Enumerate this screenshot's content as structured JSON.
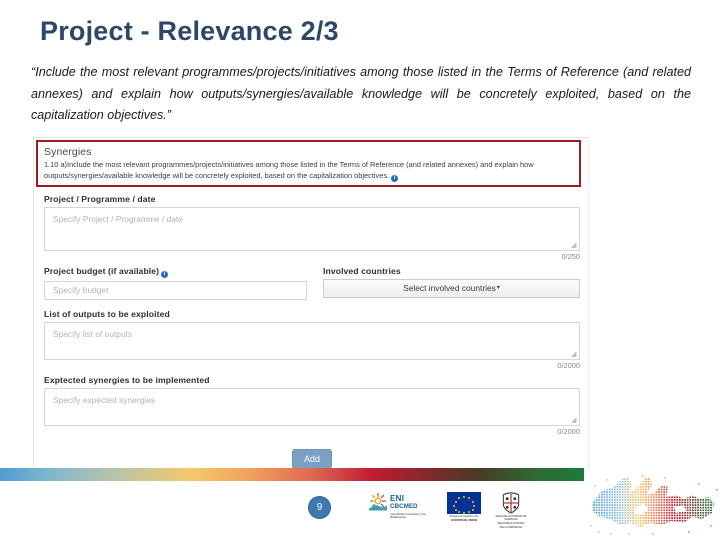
{
  "slide": {
    "title": "Project - Relevance 2/3",
    "intro": "“Include the most relevant programmes/projects/initiatives among those listed in the Terms of Reference (and related annexes) and explain how outputs/synergies/available knowledge will be concretely exploited, based on the capitalization objectives.”"
  },
  "screenshot": {
    "highlight": {
      "title": "Synergies",
      "text": "1.10 a)Include the most relevant programmes/projects/initiatives among those listed in the Terms of Reference (and related annexes) and explain how outputs/synergies/available knowledge will be concretely exploited, based on the capitalization objectives.",
      "info_icon": "info-icon",
      "border_color": "#9e1b20"
    },
    "fields": {
      "project_programme_date": {
        "label": "Project / Programme / date",
        "placeholder": "Specify Project / Programme / date",
        "value": "",
        "counter": "0/250"
      },
      "project_budget": {
        "label": "Project budget (if available)",
        "placeholder": "Specify budget",
        "value": "",
        "info_icon": "info-icon"
      },
      "involved_countries": {
        "label": "Involved countries",
        "button_label": "Select involved countries",
        "caret": "▾"
      },
      "list_of_outputs": {
        "label": "List of outputs to be exploited",
        "placeholder": "Specify list of outputs",
        "value": "",
        "counter": "0/2000"
      },
      "expected_synergies": {
        "label": "Exptected synergies to be implemented",
        "placeholder": "Specify expected synergies",
        "value": "",
        "counter": "0/2000"
      }
    },
    "add_button": {
      "label": "Add",
      "color": "#7ba0c4"
    }
  },
  "footer": {
    "page_number": "9",
    "eni_logo": {
      "line1": "ENI",
      "line2": "CBCMED",
      "caption": "Cross-Border Cooperation in the Mediterranean"
    },
    "eu_logo": {
      "caption_line1": "Programme funded by the",
      "caption_line2": "EUROPEAN UNION"
    },
    "region_logo": {
      "caption_line1": "REGIONE AUTONOMA DE SARDIGNA",
      "caption_line2": "REGIONE AUTONOMA DELLA SARDEGNA"
    },
    "gradient_colors": [
      "#4f9ed0",
      "#f4c86a",
      "#e06a52",
      "#c01b33",
      "#1d7a3c"
    ]
  }
}
